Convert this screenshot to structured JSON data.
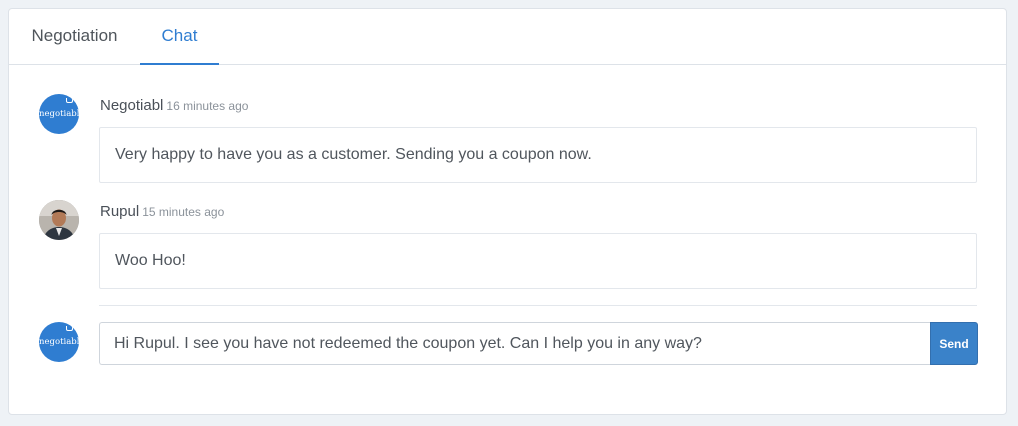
{
  "tabs": [
    {
      "label": "Negotiation",
      "active": false
    },
    {
      "label": "Chat",
      "active": true
    }
  ],
  "messages": [
    {
      "author": "Negotiabl",
      "time": "16 minutes ago",
      "text": "Very happy to have you as a customer. Sending you a coupon now.",
      "avatar": "negotiabl-logo-icon"
    },
    {
      "author": "Rupul",
      "time": "15 minutes ago",
      "text": "Woo Hoo!",
      "avatar": "user-photo"
    }
  ],
  "brand": {
    "logo_text": "negotiabl",
    "color": "#2f7dd1"
  },
  "reply": {
    "value": "Hi Rupul. I see you have not redeemed the coupon yet. Can I help you in any way?",
    "send_label": "Send"
  },
  "colors": {
    "accent": "#2f7dd1",
    "send_button": "#3a82c9"
  }
}
